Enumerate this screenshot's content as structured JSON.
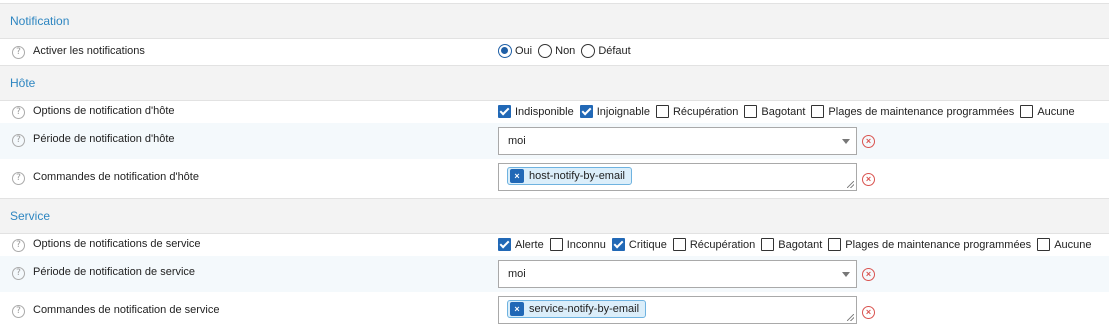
{
  "notification": {
    "header": "Notification",
    "enable": {
      "label": "Activer les notifications",
      "options": [
        "Oui",
        "Non",
        "Défaut"
      ],
      "selected": "Oui"
    }
  },
  "host": {
    "header": "Hôte",
    "options_label": "Options de notification d'hôte",
    "options": [
      {
        "label": "Indisponible",
        "checked": true
      },
      {
        "label": "Injoignable",
        "checked": true
      },
      {
        "label": "Récupération",
        "checked": false
      },
      {
        "label": "Bagotant",
        "checked": false
      },
      {
        "label": "Plages de maintenance programmées",
        "checked": false
      },
      {
        "label": "Aucune",
        "checked": false
      }
    ],
    "period_label": "Période de notification d'hôte",
    "period_value": "moi",
    "commands_label": "Commandes de notification d'hôte",
    "commands": [
      "host-notify-by-email"
    ]
  },
  "service": {
    "header": "Service",
    "options_label": "Options de notifications de service",
    "options": [
      {
        "label": "Alerte",
        "checked": true
      },
      {
        "label": "Inconnu",
        "checked": false
      },
      {
        "label": "Critique",
        "checked": true
      },
      {
        "label": "Récupération",
        "checked": false
      },
      {
        "label": "Bagotant",
        "checked": false
      },
      {
        "label": "Plages de maintenance programmées",
        "checked": false
      },
      {
        "label": "Aucune",
        "checked": false
      }
    ],
    "period_label": "Période de notification de service",
    "period_value": "moi",
    "commands_label": "Commandes de notification de service",
    "commands": [
      "service-notify-by-email"
    ]
  },
  "icons": {
    "help": "?",
    "clear": "×",
    "tag_remove": "×"
  },
  "colors": {
    "header_text": "#2e86c1",
    "checked": "#2168b6",
    "clear": "#d9534f"
  }
}
